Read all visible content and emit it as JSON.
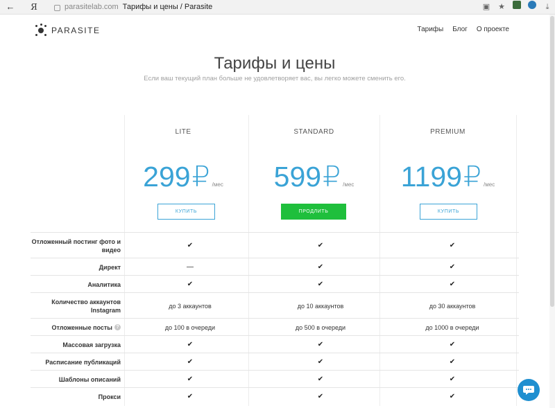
{
  "browser": {
    "back_icon": "←",
    "ya_label": "Я",
    "domain": "parasitelab.com",
    "title": "Тарифы и цены / Parasite",
    "star_icon": "★",
    "download_icon": "⤓"
  },
  "site": {
    "logo_text": "PARASITE",
    "nav": [
      "Тарифы",
      "Блог",
      "О проекте"
    ]
  },
  "hero": {
    "title": "Тарифы и цены",
    "subtitle": "Если ваш текущий план больше не удовлетворяет вас, вы легко можете сменить его."
  },
  "plans": [
    {
      "name": "LITE",
      "price": "299",
      "currency": "₽",
      "period": "/мес",
      "button": "КУПИТЬ"
    },
    {
      "name": "STANDARD",
      "price": "599",
      "currency": "₽",
      "period": "/мес",
      "button": "ПРОДЛИТЬ"
    },
    {
      "name": "PREMIUM",
      "price": "1199",
      "currency": "₽",
      "period": "/мес",
      "button": "КУПИТЬ"
    }
  ],
  "features": [
    {
      "label": "Отложенный постинг фото и видео",
      "values": [
        "✔",
        "✔",
        "✔"
      ]
    },
    {
      "label": "Директ",
      "values": [
        "—",
        "✔",
        "✔"
      ]
    },
    {
      "label": "Аналитика",
      "values": [
        "✔",
        "✔",
        "✔"
      ]
    },
    {
      "label": "Количество аккаунтов Instagram",
      "values": [
        "до 3 аккаунтов",
        "до 10 аккаунтов",
        "до 30 аккаунтов"
      ]
    },
    {
      "label": "Отложенные посты",
      "help": "?",
      "values": [
        "до 100 в очереди",
        "до 500 в очереди",
        "до 1000 в очереди"
      ]
    },
    {
      "label": "Массовая загрузка",
      "values": [
        "✔",
        "✔",
        "✔"
      ]
    },
    {
      "label": "Расписание публикаций",
      "values": [
        "✔",
        "✔",
        "✔"
      ]
    },
    {
      "label": "Шаблоны описаний",
      "values": [
        "✔",
        "✔",
        "✔"
      ]
    },
    {
      "label": "Прокси",
      "values": [
        "✔",
        "✔",
        "✔"
      ]
    }
  ],
  "colors": {
    "accent": "#3aa3d6",
    "primary_button": "#1fbf3c",
    "chat": "#1f8fd0"
  }
}
